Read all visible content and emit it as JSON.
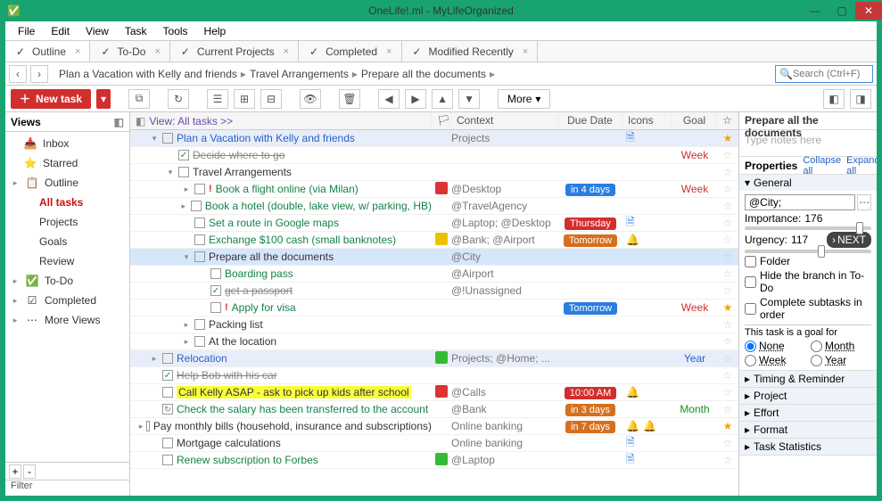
{
  "title": "OneLife!.ml - MyLifeOrganized",
  "menu": [
    "File",
    "Edit",
    "View",
    "Task",
    "Tools",
    "Help"
  ],
  "tabs": [
    {
      "label": "Outline",
      "icon": "check-red",
      "active": true
    },
    {
      "label": "To-Do",
      "icon": "check-green"
    },
    {
      "label": "Current Projects",
      "icon": "projects"
    },
    {
      "label": "Completed",
      "icon": "check-gray"
    },
    {
      "label": "Modified Recently",
      "icon": "clock"
    }
  ],
  "breadcrumbs": [
    "Plan a Vacation with Kelly and friends",
    "Travel Arrangements",
    "Prepare all the documents"
  ],
  "search_placeholder": "Search (Ctrl+F)",
  "toolbar": {
    "new_task": "New task",
    "more": "More"
  },
  "views": {
    "header": "Views",
    "items": [
      {
        "label": "Inbox",
        "icon": "inbox"
      },
      {
        "label": "Starred",
        "icon": "star"
      },
      {
        "label": "Outline",
        "icon": "outline",
        "group": true,
        "children": [
          {
            "label": "All tasks",
            "active": true
          },
          {
            "label": "Projects"
          },
          {
            "label": "Goals"
          },
          {
            "label": "Review"
          }
        ]
      },
      {
        "label": "To-Do",
        "icon": "check",
        "group": true
      },
      {
        "label": "Completed",
        "icon": "check-gray",
        "group": true
      },
      {
        "label": "More Views",
        "icon": "more",
        "group": true
      }
    ],
    "filter": "Filter"
  },
  "columns": {
    "view_label": "View: All tasks >>",
    "context": "Context",
    "due": "Due Date",
    "icons": "Icons",
    "goal": "Goal"
  },
  "tasks": [
    {
      "title": "Plan a Vacation with Kelly and friends",
      "indent": 0,
      "style": "link",
      "exp": "open",
      "blue": true,
      "ctx": "Projects",
      "icons": [
        "doc"
      ],
      "star": true
    },
    {
      "title": "Decide where to go",
      "indent": 1,
      "style": "done",
      "checked": true,
      "goal": "Week",
      "goalClass": "week"
    },
    {
      "title": "Travel Arrangements",
      "indent": 1,
      "style": "cat",
      "exp": "open"
    },
    {
      "title": "Book a flight online (via Milan)",
      "indent": 2,
      "bang": true,
      "exp": "closed",
      "flag": "red",
      "ctx": "@Desktop",
      "due": "in 4 days",
      "dueClass": "blue",
      "goal": "Week",
      "goalClass": "week"
    },
    {
      "title": "Book a hotel (double, lake view, w/ parking, HB)",
      "indent": 2,
      "exp": "closed",
      "ctx": "@TravelAgency"
    },
    {
      "title": "Set a route in Google maps",
      "indent": 2,
      "ctx": "@Laptop; @Desktop",
      "due": "Thursday",
      "dueClass": "red",
      "icons": [
        "doc"
      ]
    },
    {
      "title": "Exchange $100 cash (small banknotes)",
      "indent": 2,
      "flag": "yel",
      "ctx": "@Bank; @Airport",
      "due": "Tomorrow",
      "dueClass": "orange",
      "icons": [
        "bell"
      ]
    },
    {
      "title": "Prepare all the documents",
      "indent": 2,
      "style": "cat",
      "exp": "open",
      "sel": true,
      "ctx": "@City"
    },
    {
      "title": "Boarding pass",
      "indent": 3,
      "ctx": "@Airport"
    },
    {
      "title": "get a passport",
      "indent": 3,
      "style": "done",
      "checked": true,
      "ctx": "@!Unassigned"
    },
    {
      "title": "Apply for visa",
      "indent": 3,
      "bang": true,
      "due": "Tomorrow",
      "dueClass": "blue",
      "goal": "Week",
      "goalClass": "week",
      "star": true
    },
    {
      "title": "Packing list",
      "indent": 2,
      "style": "cat",
      "exp": "closed"
    },
    {
      "title": "At the location",
      "indent": 2,
      "style": "cat",
      "exp": "closed"
    },
    {
      "title": "Relocation",
      "indent": 0,
      "style": "link",
      "exp": "closed",
      "blue": true,
      "flag": "grn",
      "ctx": "Projects; @Home; ...",
      "goal": "Year",
      "goalClass": "year"
    },
    {
      "title": "Help Bob with his car",
      "indent": 0,
      "style": "done",
      "checked": true
    },
    {
      "title": "Call Kelly ASAP - ask to pick up kids after school",
      "indent": 0,
      "style": "hi",
      "flag": "red",
      "ctx": "@Calls",
      "due": "10:00 AM",
      "dueClass": "red",
      "icons": [
        "bell"
      ]
    },
    {
      "title": "Check the salary has been transferred to the account",
      "indent": 0,
      "cycle": true,
      "ctx": "@Bank",
      "due": "in 3 days",
      "dueClass": "orange",
      "goal": "Month",
      "goalClass": "month"
    },
    {
      "title": "Pay monthly bills (household, insurance and subscriptions)",
      "indent": 0,
      "style": "cat",
      "exp": "closed",
      "ctx": "Online banking",
      "due": "in 7 days",
      "dueClass": "orange",
      "icons": [
        "bell",
        "bell"
      ],
      "star": true
    },
    {
      "title": "Mortgage calculations",
      "indent": 0,
      "style": "cat",
      "ctx": "Online banking",
      "icons": [
        "doc"
      ]
    },
    {
      "title": "Renew subscription to Forbes",
      "indent": 0,
      "flag": "grn",
      "ctx": "@Laptop",
      "icons": [
        "doc"
      ]
    }
  ],
  "props": {
    "title": "Prepare all the documents",
    "notes_placeholder": "Type notes here",
    "header": "Properties",
    "collapse": "Collapse all",
    "expand": "Expand all",
    "general": "General",
    "context_value": "@City;",
    "importance_label": "Importance:",
    "importance_val": "176",
    "importance_pct": 88,
    "urgency_label": "Urgency:",
    "urgency_val": "117",
    "urgency_pct": 58,
    "next": "NEXT",
    "folder": "Folder",
    "hide": "Hide the branch in To-Do",
    "complete": "Complete subtasks in order",
    "goal_label": "This task is a goal for",
    "goal_opts": [
      "None",
      "Month",
      "Week",
      "Year"
    ],
    "sections": [
      "Timing & Reminder",
      "Project",
      "Effort",
      "Format",
      "Task Statistics"
    ]
  }
}
